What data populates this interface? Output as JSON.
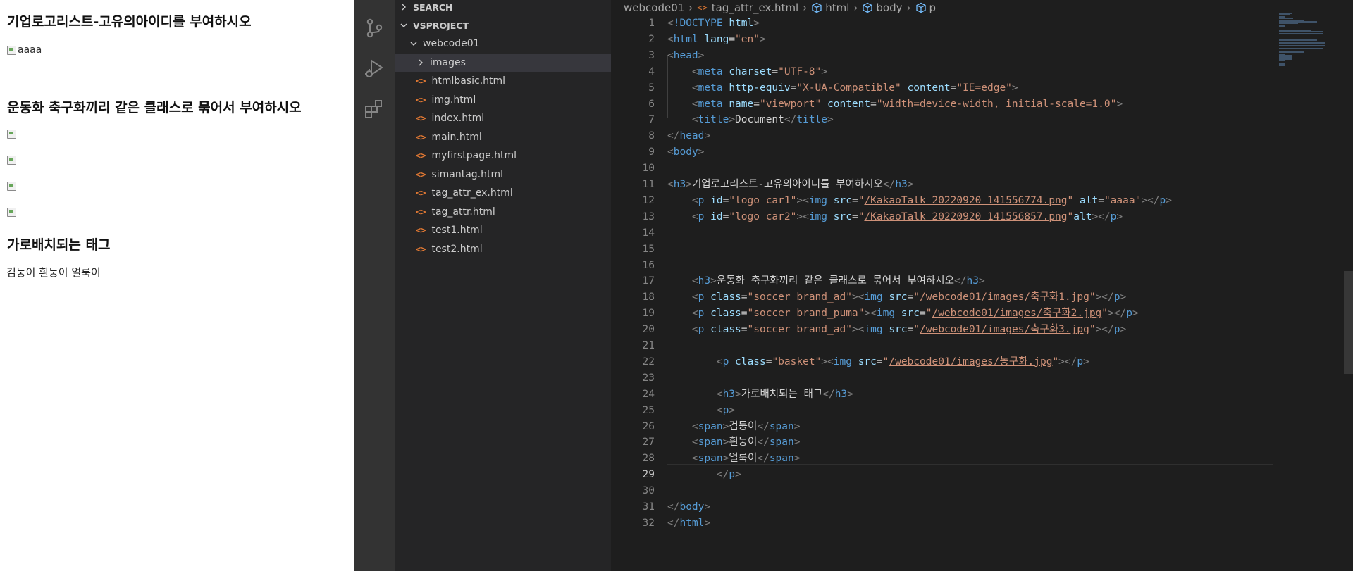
{
  "preview": {
    "heading1": "기업로고리스트-고유의아이디를 부여하시오",
    "image1_alt": "aaaa",
    "heading2": "운동화 축구화끼리 같은 클래스로 묶어서 부여하시오",
    "heading3": "가로배치되는 태그",
    "span_text": "검둥이 흰둥이 얼룩이"
  },
  "activity_bar": {
    "icons": [
      "source-control-icon",
      "run-debug-icon",
      "extensions-icon"
    ]
  },
  "sidebar": {
    "search_label": "SEARCH",
    "project_label": "VSPROJECT",
    "folder": "webcode01",
    "subfolder": "images",
    "file_tag": "<>",
    "files": [
      "htmlbasic.html",
      "img.html",
      "index.html",
      "main.html",
      "myfirstpage.html",
      "simantag.html",
      "tag_attr_ex.html",
      "tag_attr.html",
      "test1.html",
      "test2.html"
    ]
  },
  "breadcrumbs": {
    "folder": "webcode01",
    "file": "tag_attr_ex.html",
    "items": [
      "html",
      "body",
      "p"
    ]
  },
  "editor": {
    "active_line": 29,
    "line_numbers": [
      "1",
      "2",
      "3",
      "4",
      "5",
      "6",
      "7",
      "8",
      "9",
      "10",
      "11",
      "12",
      "13",
      "14",
      "15",
      "16",
      "17",
      "18",
      "19",
      "20",
      "21",
      "22",
      "23",
      "24",
      "25",
      "26",
      "27",
      "28",
      "29",
      "30",
      "31",
      "32"
    ]
  },
  "colors": {
    "editor_bg": "#1e1e1e",
    "sidebar_bg": "#252526",
    "activity_bg": "#333333",
    "tag": "#569cd6",
    "attr": "#9cdcfe",
    "string": "#ce9178",
    "file_icon": "#e37933"
  }
}
